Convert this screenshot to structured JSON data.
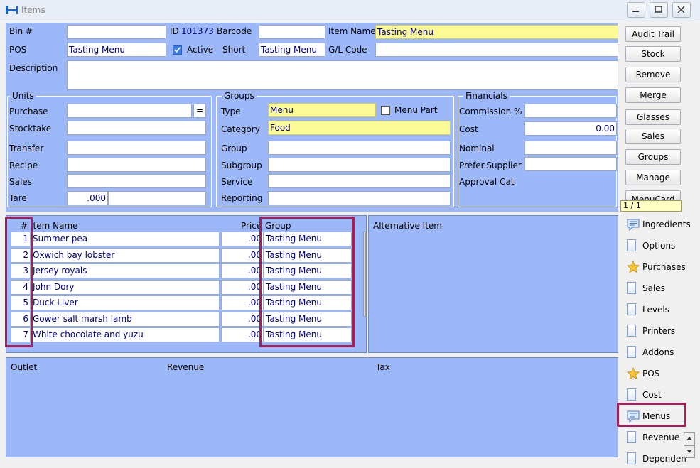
{
  "window": {
    "title": "Items"
  },
  "form": {
    "bin_label": "Bin #",
    "bin_value": "",
    "id_label": "ID",
    "id_value": "101373",
    "barcode_label": "Barcode",
    "barcode_value": "",
    "item_name_label": "Item Name",
    "item_name_value": "Tasting Menu",
    "pos_label": "POS",
    "pos_value": "Tasting Menu",
    "active_label": "Active",
    "active_checked": true,
    "short_label": "Short",
    "short_value": "Tasting Menu",
    "gl_label": "G/L Code",
    "gl_value": "",
    "description_label": "Description",
    "description_value": ""
  },
  "units": {
    "title": "Units",
    "purchase_label": "Purchase",
    "purchase_value": "",
    "purchase_btn": "=",
    "stocktake_label": "Stocktake",
    "stocktake_value": "",
    "transfer_label": "Transfer",
    "transfer_value": "",
    "recipe_label": "Recipe",
    "recipe_value": "",
    "sales_label": "Sales",
    "sales_value": "",
    "tare_label": "Tare",
    "tare_value": ".000"
  },
  "groups": {
    "title": "Groups",
    "type_label": "Type",
    "type_value": "Menu",
    "menu_part_label": "Menu Part",
    "menu_part_checked": false,
    "category_label": "Category",
    "category_value": "Food",
    "group_label": "Group",
    "group_value": "",
    "subgroup_label": "Subgroup",
    "subgroup_value": "",
    "service_label": "Service",
    "service_value": "",
    "reporting_label": "Reporting",
    "reporting_value": ""
  },
  "financials": {
    "title": "Financials",
    "commission_label": "Commission %",
    "commission_value": "",
    "cost_label": "Cost",
    "cost_value": "0.00",
    "nominal_label": "Nominal",
    "nominal_value": "",
    "prefer_supplier_label": "Prefer.Supplier",
    "prefer_supplier_value": "",
    "approval_cat_label": "Approval Cat"
  },
  "actions": [
    "Audit Trail",
    "Stock",
    "Remove",
    "Merge",
    "Glasses",
    "Sales",
    "Groups",
    "Manage",
    "MenuCard"
  ],
  "page_indicator": "1 / 1",
  "grid": {
    "headers": {
      "num": "#",
      "item_name": "Item Name",
      "price": "Price",
      "group": "Group"
    },
    "rows": [
      {
        "num": "1",
        "item_name": "Summer pea",
        "price": ".00",
        "group": "Tasting Menu"
      },
      {
        "num": "2",
        "item_name": "Oxwich bay lobster",
        "price": ".00",
        "group": "Tasting Menu"
      },
      {
        "num": "3",
        "item_name": "Jersey royals",
        "price": ".00",
        "group": "Tasting Menu"
      },
      {
        "num": "4",
        "item_name": "John Dory",
        "price": ".00",
        "group": "Tasting Menu"
      },
      {
        "num": "5",
        "item_name": "Duck Liver",
        "price": ".00",
        "group": "Tasting Menu"
      },
      {
        "num": "6",
        "item_name": "Gower salt marsh lamb",
        "price": ".00",
        "group": "Tasting Menu"
      },
      {
        "num": "7",
        "item_name": "White chocolate and yuzu",
        "price": ".00",
        "group": "Tasting Menu"
      }
    ]
  },
  "alt_panel": {
    "header": "Alternative Item"
  },
  "bottom": {
    "outlet": "Outlet",
    "revenue": "Revenue",
    "tax": "Tax"
  },
  "tabs": [
    {
      "label": "Ingredients",
      "icon": "notes-icon"
    },
    {
      "label": "Options",
      "icon": "page-icon"
    },
    {
      "label": "Purchases",
      "icon": "star-icon"
    },
    {
      "label": "Sales",
      "icon": "page-icon"
    },
    {
      "label": "Levels",
      "icon": "page-icon"
    },
    {
      "label": "Printers",
      "icon": "page-icon"
    },
    {
      "label": "Addons",
      "icon": "page-icon"
    },
    {
      "label": "POS",
      "icon": "star-icon"
    },
    {
      "label": "Cost",
      "icon": "page-icon"
    },
    {
      "label": "Menus",
      "icon": "notes-icon"
    },
    {
      "label": "Revenue",
      "icon": "page-icon"
    },
    {
      "label": "Dependen",
      "icon": "page-icon"
    }
  ],
  "colors": {
    "panel": "#9db8f8",
    "highlight": "#a0205a",
    "required_field": "#fdfb96"
  }
}
